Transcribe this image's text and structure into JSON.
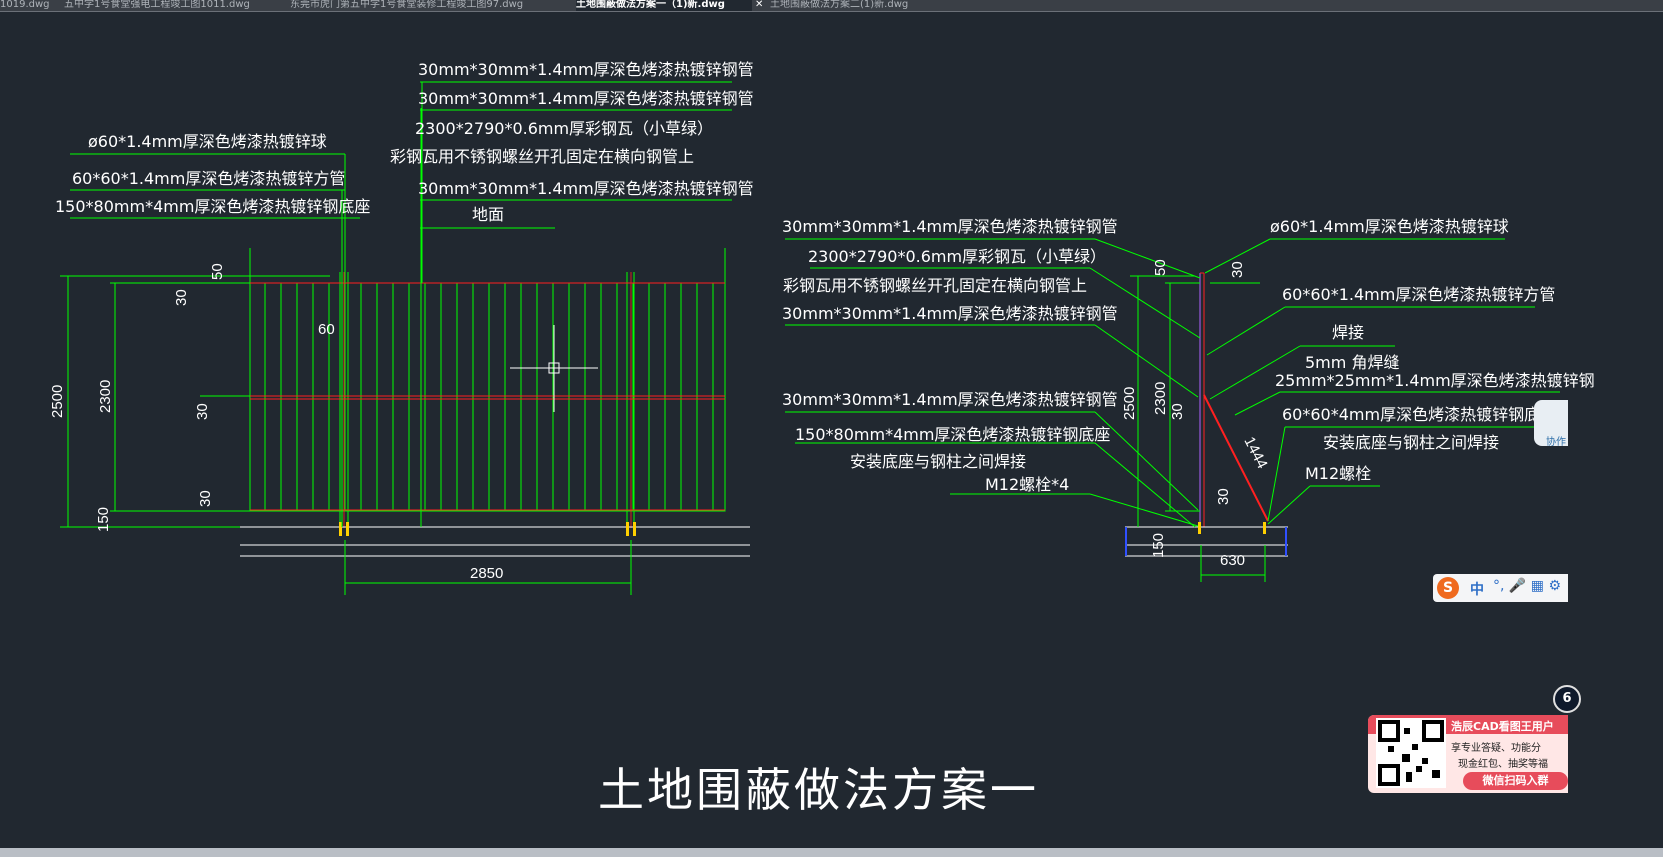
{
  "tabs": [
    {
      "label": "1019.dwg",
      "active": false
    },
    {
      "label": "五中学1号食堂强电工程竣工图1011.dwg",
      "active": false
    },
    {
      "label": "东莞市虎门第五中学1号食堂装修工程竣工图97.dwg",
      "active": false
    },
    {
      "label": "土地围蔽做法方案一（1)新.dwg",
      "active": true
    },
    {
      "label": "土地围蔽做法方案二(1)新.dwg",
      "active": false
    }
  ],
  "tab_close_glyph": "✕",
  "drawing": {
    "title": "土地围蔽做法方案一",
    "front_view": {
      "labels": [
        "30mm*30mm*1.4mm厚深色烤漆热镀锌钢管",
        "30mm*30mm*1.4mm厚深色烤漆热镀锌钢管",
        "2300*2790*0.6mm厚彩钢瓦（小草绿）",
        "彩钢瓦用不锈钢螺丝开孔固定在横向钢管上",
        "30mm*30mm*1.4mm厚深色烤漆热镀锌钢管",
        "地面",
        "ø60*1.4mm厚深色烤漆热镀锌球",
        "60*60*1.4mm厚深色烤漆热镀锌方管",
        "150*80mm*4mm厚深色烤漆热镀锌钢底座"
      ],
      "dims": [
        "50",
        "30",
        "60",
        "2500",
        "2300",
        "30",
        "30",
        "150",
        "2850"
      ]
    },
    "side_view": {
      "labels": [
        "30mm*30mm*1.4mm厚深色烤漆热镀锌钢管",
        "2300*2790*0.6mm厚彩钢瓦（小草绿）",
        "彩钢瓦用不锈钢螺丝开孔固定在横向钢管上",
        "30mm*30mm*1.4mm厚深色烤漆热镀锌钢管",
        "30mm*30mm*1.4mm厚深色烤漆热镀锌钢管",
        "150*80mm*4mm厚深色烤漆热镀锌钢底座",
        "安装底座与钢柱之间焊接",
        "M12螺栓*4",
        "ø60*1.4mm厚深色烤漆热镀锌球",
        "60*60*1.4mm厚深色烤漆热镀锌方管",
        "焊接",
        "5mm 角焊缝",
        "25mm*25mm*1.4mm厚深色烤漆热镀锌钢",
        "60*60*4mm厚深色烤漆热镀锌钢底",
        "安装底座与钢柱之间焊接",
        "M12螺栓"
      ],
      "dims": [
        "50",
        "30",
        "2500",
        "2300",
        "30",
        "1444",
        "30",
        "150",
        "630"
      ]
    }
  },
  "overlays": {
    "collab_label": "协作",
    "ime": {
      "logo": "S",
      "lang": "中",
      "icons": "°, 🎤 ▦ ⚙"
    },
    "promo": {
      "title": "浩辰CAD看图王用户",
      "line1": "享专业答疑、功能分",
      "line2": "现金红包、抽奖等福",
      "button": "微信扫码入群"
    },
    "badge": "6"
  },
  "colors": {
    "background": "#212830",
    "line": "#00ff00",
    "accent_red": "#ff2020",
    "text": "#ffffff"
  }
}
